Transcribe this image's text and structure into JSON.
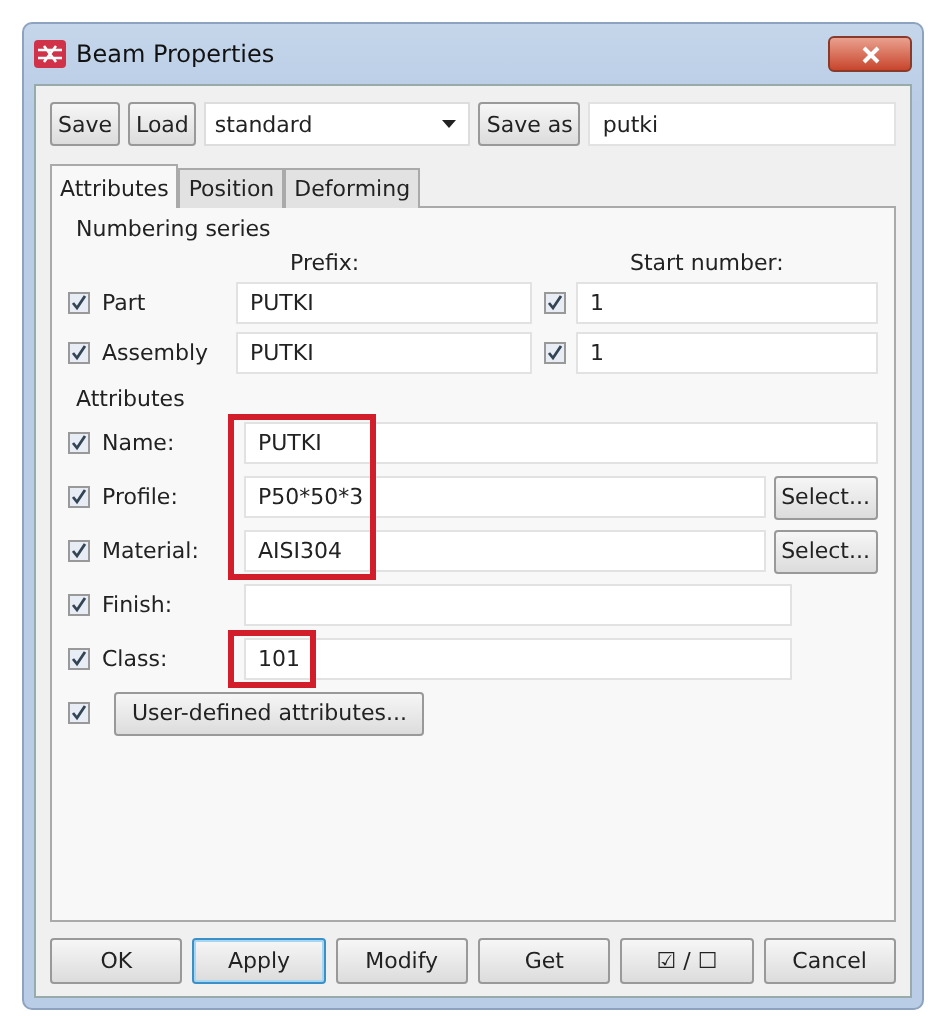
{
  "window": {
    "title": "Beam Properties"
  },
  "toolbar": {
    "save": "Save",
    "load": "Load",
    "preset": "standard",
    "save_as": "Save as",
    "save_name": "putki"
  },
  "tabs": [
    {
      "label": "Attributes",
      "selected": true
    },
    {
      "label": "Position",
      "selected": false
    },
    {
      "label": "Deforming",
      "selected": false
    }
  ],
  "numbering": {
    "title": "Numbering series",
    "prefix_header": "Prefix:",
    "start_header": "Start number:",
    "rows": [
      {
        "label": "Part",
        "checked": true,
        "prefix": "PUTKI",
        "start_checked": true,
        "start": "1"
      },
      {
        "label": "Assembly",
        "checked": true,
        "prefix": "PUTKI",
        "start_checked": true,
        "start": "1"
      }
    ]
  },
  "attributes": {
    "title": "Attributes",
    "rows": [
      {
        "label": "Name:",
        "checked": true,
        "value": "PUTKI",
        "highlighted": true,
        "wide": true
      },
      {
        "label": "Profile:",
        "checked": true,
        "value": "P50*50*3",
        "highlighted": true,
        "wide": false,
        "button": "Select..."
      },
      {
        "label": "Material:",
        "checked": true,
        "value": "AISI304",
        "highlighted": true,
        "wide": false,
        "button": "Select..."
      },
      {
        "label": "Finish:",
        "checked": true,
        "value": "",
        "highlighted": false,
        "wide": false
      },
      {
        "label": "Class:",
        "checked": true,
        "value": "101",
        "highlighted": true,
        "wide": false
      }
    ],
    "user_defined": {
      "checked": true,
      "label": "User-defined attributes..."
    }
  },
  "buttons": [
    {
      "label": "OK",
      "focused": false
    },
    {
      "label": "Apply",
      "focused": true
    },
    {
      "label": "Modify",
      "focused": false
    },
    {
      "label": "Get",
      "focused": false
    },
    {
      "label": "☑ / ☐",
      "focused": false
    },
    {
      "label": "Cancel",
      "focused": false
    }
  ]
}
